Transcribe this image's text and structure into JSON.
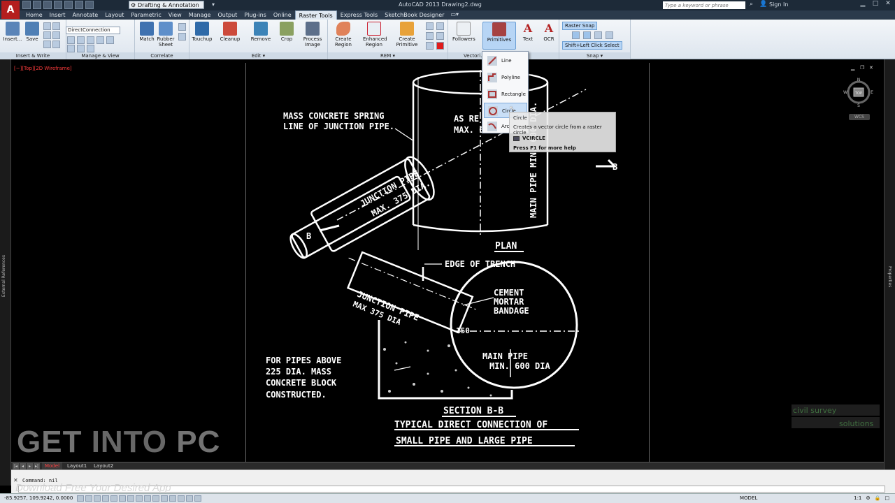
{
  "app": {
    "logo": "A",
    "title": "AutoCAD 2013    Drawing2.dwg",
    "workspace": "Drafting & Annotation",
    "search_placeholder": "Type a keyword or phrase",
    "signin": "Sign In"
  },
  "tabs": [
    "Home",
    "Insert",
    "Annotate",
    "Layout",
    "Parametric",
    "View",
    "Manage",
    "Output",
    "Plug-ins",
    "Online",
    "Raster Tools",
    "Express Tools",
    "SketchBook Designer"
  ],
  "active_tab": "Raster Tools",
  "ribbon": {
    "insert_write": {
      "title": "Insert & Write",
      "insert": "Insert...",
      "save": "Save"
    },
    "manage_view": {
      "title": "Manage & View",
      "dropdown": "DirectConnection"
    },
    "correlate": {
      "title": "Correlate",
      "match": "Match",
      "rubber_sheet": "Rubber Sheet"
    },
    "edit": {
      "title": "Edit",
      "touchup": "Touchup",
      "cleanup": "Cleanup",
      "remove": "Remove",
      "crop": "Crop",
      "process_image": "Process Image"
    },
    "rem": {
      "title": "REM",
      "create_region": "Create Region",
      "enhanced_region": "Enhanced Region",
      "create_primitive": "Create Primitive"
    },
    "vectorize": {
      "title": "Vectori...",
      "followers": "Followers",
      "primitives": "Primitives",
      "text": "Text",
      "ocr": "OCR"
    },
    "snap": {
      "title": "Snap",
      "raster_snap": "Raster Snap",
      "shift_left": "Shift+Left Click Select"
    }
  },
  "flyout": {
    "items": [
      {
        "label": "Line",
        "icon": "line-icon"
      },
      {
        "label": "Polyline",
        "icon": "polyline-icon"
      },
      {
        "label": "Rectangle",
        "icon": "rectangle-icon"
      },
      {
        "label": "Circle",
        "icon": "circle-icon"
      },
      {
        "label": "Arc",
        "icon": "arc-icon"
      }
    ]
  },
  "tooltip": {
    "title": "Circle",
    "description": "Creates a vector circle from a raster circle",
    "command": "VCIRCLE",
    "help": "Press F1 for more help"
  },
  "viewport": {
    "label": "[−][Top][2D Wireframe]",
    "compass": {
      "n": "N",
      "s": "S",
      "e": "E",
      "w": "W",
      "top": "TOP"
    },
    "wcs": "WCS"
  },
  "drawing": {
    "spring_line": [
      "MASS CONCRETE SPRING",
      "LINE OF JUNCTION PIPE."
    ],
    "as_re": "AS RE",
    "max6": "MAX. 6",
    "junction_pipe": "JUNCTION PIPE",
    "max375": "MAX. 375 DIA.",
    "main_pipe_plan": "MAIN PIPE MIN. 600 DIA.",
    "b_left": "B",
    "b_right": "B",
    "plan": "PLAN",
    "edge_of_trench": "EDGE OF TRENCH",
    "cement": [
      "CEMENT",
      "MORTAR",
      "BANDAGE"
    ],
    "junction_pipe2": "JUNCTION PIPE",
    "max375_2": "MAX   375 DIA",
    "dim150": "150",
    "main_pipe_sec": [
      "MAIN PIPE",
      "MIN. 600 DIA"
    ],
    "for_pipes": [
      "FOR PIPES ABOVE",
      "225 DIA. MASS",
      "CONCRETE BLOCK",
      "CONSTRUCTED."
    ],
    "section": "SECTION B-B",
    "caption": [
      "TYPICAL DIRECT CONNECTION OF",
      "SMALL PIPE AND LARGE PIPE"
    ]
  },
  "side": {
    "left": "External References",
    "right": "Properties"
  },
  "layout_tabs": [
    "Model",
    "Layout1",
    "Layout2"
  ],
  "command": {
    "history": "Command: nil"
  },
  "status": {
    "coords": "-85.9257, 109.9242, 0.0000",
    "model": "MODEL",
    "scale": "1:1"
  },
  "watermark": {
    "line1": "civil survey",
    "line2": "solutions"
  },
  "overlay": {
    "get": "GET",
    "into": "INTO",
    "pc": "PC",
    "tagline": "Download Free Your Desired App"
  }
}
